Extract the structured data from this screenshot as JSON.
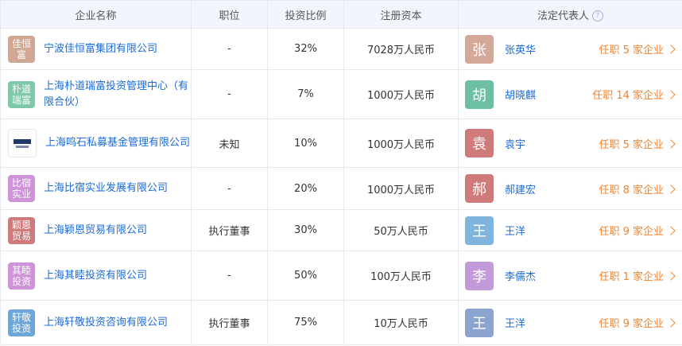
{
  "headers": {
    "company": "企业名称",
    "position": "职位",
    "ratio": "投资比例",
    "capital": "注册资本",
    "legal": "法定代表人"
  },
  "rows": [
    {
      "logo_text": "佳恒\n富",
      "logo_color": "#cfa793",
      "company": "宁波佳恒富集团有限公司",
      "position": "-",
      "ratio": "32%",
      "capital": "7028万人民币",
      "avatar": "张",
      "avatar_color": "#d3a899",
      "person": "张英华",
      "tenure": "任职 5 家企业"
    },
    {
      "logo_text": "朴道\n瑞富",
      "logo_color": "#7fc8a9",
      "company": "上海朴道瑞富投资管理中心（有限合伙）",
      "position": "-",
      "ratio": "7%",
      "capital": "1000万人民币",
      "avatar": "胡",
      "avatar_color": "#6cbfa1",
      "person": "胡晓麒",
      "tenure": "任职 14 家企业"
    },
    {
      "logo_text": "",
      "logo_color": "#ffffff",
      "company": "上海鸣石私募基金管理有限公司",
      "position": "未知",
      "ratio": "10%",
      "capital": "1000万人民币",
      "avatar": "袁",
      "avatar_color": "#cf7b7b",
      "person": "袁宇",
      "tenure": "任职 5 家企业"
    },
    {
      "logo_text": "比宿\n实业",
      "logo_color": "#cf93d9",
      "company": "上海比宿实业发展有限公司",
      "position": "-",
      "ratio": "20%",
      "capital": "1000万人民币",
      "avatar": "郝",
      "avatar_color": "#cf7b7b",
      "person": "郝建宏",
      "tenure": "任职 8 家企业"
    },
    {
      "logo_text": "颖恩\n贸易",
      "logo_color": "#cf7b7b",
      "company": "上海颖恩贸易有限公司",
      "position": "执行董事",
      "ratio": "30%",
      "capital": "50万人民币",
      "avatar": "王",
      "avatar_color": "#7fb4dd",
      "person": "王洋",
      "tenure": "任职 9 家企业"
    },
    {
      "logo_text": "其睦\n投资",
      "logo_color": "#cf93d9",
      "company": "上海其睦投资有限公司",
      "position": "-",
      "ratio": "50%",
      "capital": "100万人民币",
      "avatar": "李",
      "avatar_color": "#c39ad9",
      "person": "李儒杰",
      "tenure": "任职 1 家企业"
    },
    {
      "logo_text": "轩敬\n投资",
      "logo_color": "#6fa6d9",
      "company": "上海轩敬投资咨询有限公司",
      "position": "执行董事",
      "ratio": "75%",
      "capital": "10万人民币",
      "avatar": "王",
      "avatar_color": "#8ba3cf",
      "person": "王洋",
      "tenure": "任职 9 家企业"
    }
  ]
}
